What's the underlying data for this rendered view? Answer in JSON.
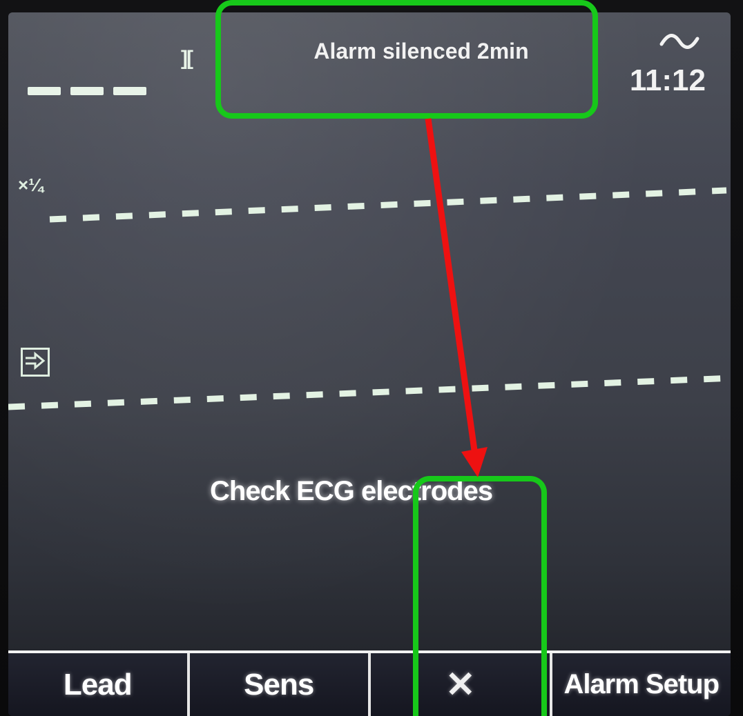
{
  "status_bar": {
    "alarm_message": "Alarm silenced 2min",
    "clock": "11:12",
    "pause_glyph": "][",
    "wave_icon": "sine-wave-icon"
  },
  "channels": {
    "scale_label": "×¼",
    "paddle_icon": "paddles-icon"
  },
  "center": {
    "message": "Check ECG electrodes"
  },
  "softkeys": [
    {
      "label": "Lead"
    },
    {
      "label": "Sens"
    },
    {
      "label": "✕",
      "icon": "alarm-silence-icon"
    },
    {
      "label": "Alarm Setup"
    }
  ],
  "annotations": {
    "highlight_color": "#17c81a",
    "arrow_color": "#ee1111"
  }
}
